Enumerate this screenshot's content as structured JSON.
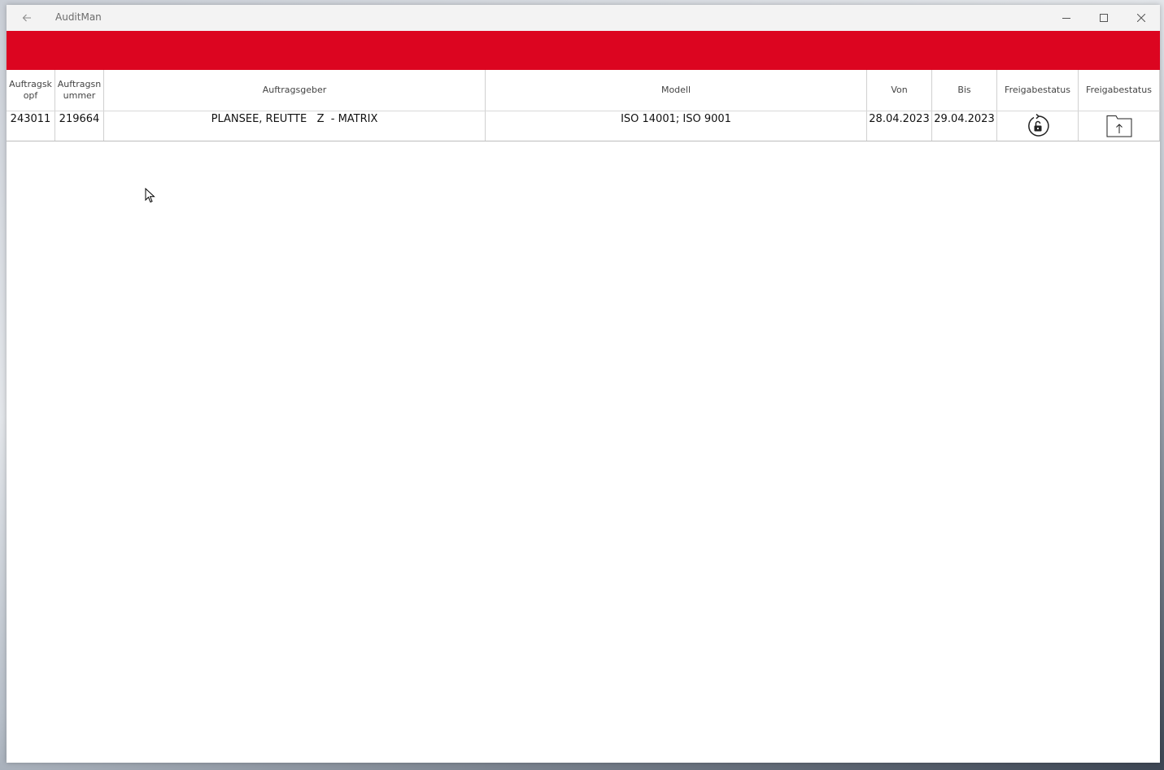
{
  "window": {
    "title": "AuditMan"
  },
  "table": {
    "headers": [
      "Auftragsk opf",
      "Auftragsn ummer",
      "Auftragsgeber",
      "Modell",
      "Von",
      "Bis",
      "Freigabestatus",
      "Freigabestatus"
    ],
    "rows": [
      {
        "kopf": "243011",
        "nummer": "219664",
        "auftraggeber": "PLANSEE, REUTTE   Z  - MATRIX",
        "modell": "ISO 14001; ISO 9001",
        "von": "28.04.2023",
        "bis": "29.04.2023",
        "status_icon": "unlock-refresh-icon",
        "upload_icon": "folder-upload-icon"
      }
    ]
  },
  "colors": {
    "accent_bar": "#dc0520",
    "titlebar": "#f3f3f3"
  }
}
